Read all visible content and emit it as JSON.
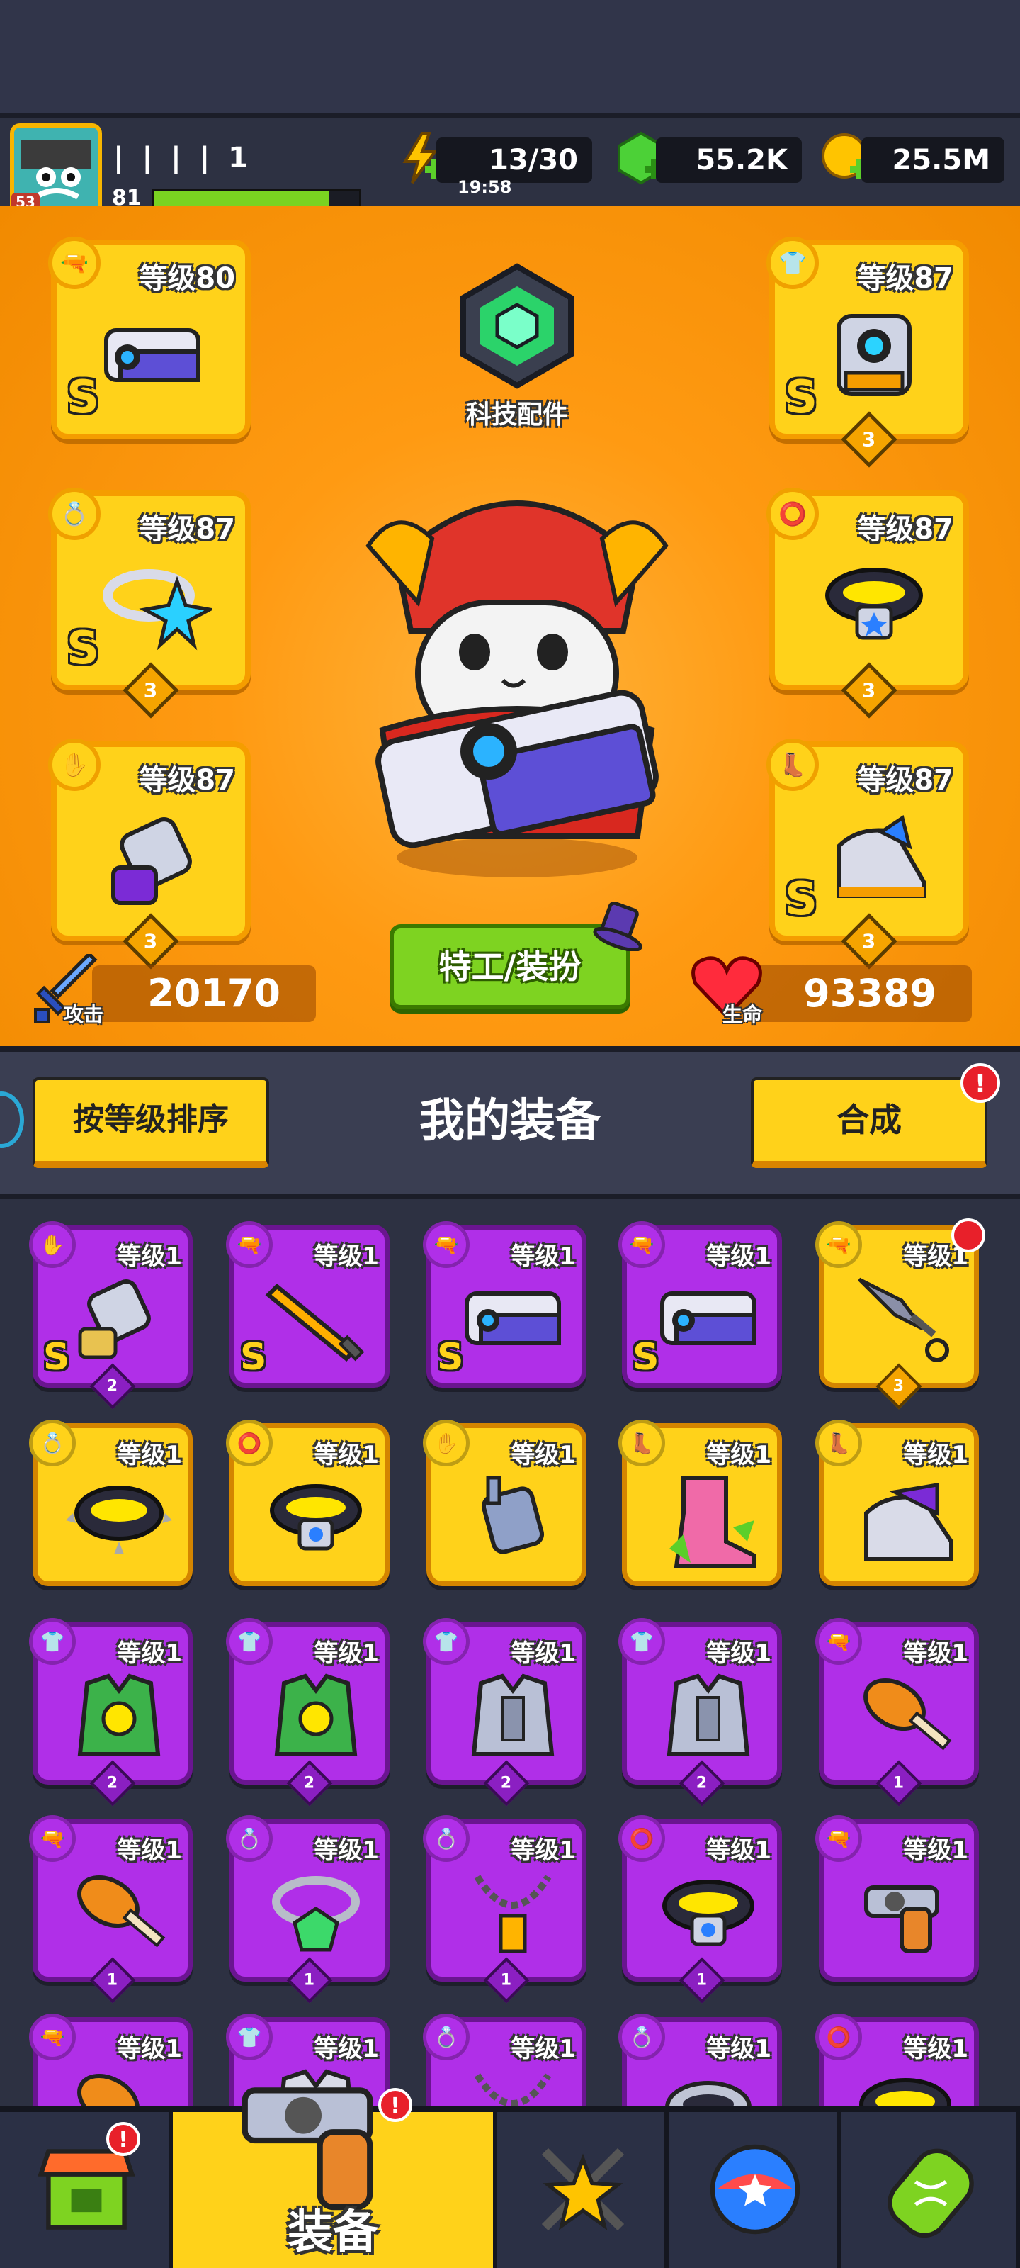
{
  "player": {
    "name": "| | | | 1",
    "level": "81",
    "avatar_badge": "53",
    "xp_fraction": 0.85
  },
  "resources": {
    "energy": {
      "value": "13/30",
      "timer": "19:58",
      "icon": "lightning-plus-icon"
    },
    "gems": {
      "value": "55.2K",
      "icon": "green-gem-plus-icon"
    },
    "coins": {
      "value": "25.5M",
      "icon": "gold-coin-plus-icon"
    }
  },
  "colors": {
    "accent": "#ff9a12",
    "gold": "#ffd21a",
    "purple": "#b02fe8",
    "green": "#7ed321",
    "alert": "#e8202a"
  },
  "equipped": {
    "weapon": {
      "level": "等级80",
      "rank": "S",
      "stars": ""
    },
    "armor": {
      "level": "等级87",
      "rank": "S",
      "stars": "3"
    },
    "ring": {
      "level": "等级87",
      "rank": "S",
      "stars": "3"
    },
    "belt": {
      "level": "等级87",
      "rank": "",
      "stars": "3"
    },
    "glove": {
      "level": "等级87",
      "rank": "",
      "stars": "3"
    },
    "boots": {
      "level": "等级87",
      "rank": "S",
      "stars": "3"
    }
  },
  "tech_label": "科技配件",
  "agent_button": "特工/装扮",
  "stats": {
    "attack_label": "攻击",
    "attack": "20170",
    "hp_label": "生命",
    "hp": "93389"
  },
  "inventory": {
    "sort_button": "按等级排序",
    "title": "我的装备",
    "merge_button": "合成",
    "merge_alert": "!",
    "items": [
      {
        "level": "等级1",
        "rank": "S",
        "stars": "2",
        "color": "purple",
        "slot": "glove",
        "icon": "gauntlet-icon"
      },
      {
        "level": "等级1",
        "rank": "S",
        "stars": "",
        "color": "purple",
        "slot": "weapon",
        "icon": "flame-sword-icon"
      },
      {
        "level": "等级1",
        "rank": "S",
        "stars": "",
        "color": "purple",
        "slot": "weapon",
        "icon": "blaster-icon"
      },
      {
        "level": "等级1",
        "rank": "S",
        "stars": "",
        "color": "purple",
        "slot": "weapon",
        "icon": "blaster-icon"
      },
      {
        "level": "等级1",
        "rank": "",
        "stars": "3",
        "color": "gold",
        "slot": "weapon",
        "icon": "kunai-icon",
        "alert": true
      },
      {
        "level": "等级1",
        "rank": "",
        "stars": "",
        "color": "gold",
        "slot": "ring",
        "icon": "spiked-collar-icon"
      },
      {
        "level": "等级1",
        "rank": "",
        "stars": "",
        "color": "gold",
        "slot": "belt",
        "icon": "belt-icon"
      },
      {
        "level": "等级1",
        "rank": "",
        "stars": "",
        "color": "gold",
        "slot": "glove",
        "icon": "steel-glove-icon"
      },
      {
        "level": "等级1",
        "rank": "",
        "stars": "",
        "color": "gold",
        "slot": "boots",
        "icon": "pink-boot-icon"
      },
      {
        "level": "等级1",
        "rank": "",
        "stars": "",
        "color": "gold",
        "slot": "boots",
        "icon": "sneaker-icon"
      },
      {
        "level": "等级1",
        "rank": "",
        "stars": "2",
        "color": "purple",
        "slot": "armor",
        "icon": "green-vest-icon"
      },
      {
        "level": "等级1",
        "rank": "",
        "stars": "2",
        "color": "purple",
        "slot": "armor",
        "icon": "green-vest-icon"
      },
      {
        "level": "等级1",
        "rank": "",
        "stars": "2",
        "color": "purple",
        "slot": "armor",
        "icon": "steel-armor-icon"
      },
      {
        "level": "等级1",
        "rank": "",
        "stars": "2",
        "color": "purple",
        "slot": "armor",
        "icon": "steel-armor-icon"
      },
      {
        "level": "等级1",
        "rank": "",
        "stars": "1",
        "color": "purple",
        "slot": "weapon",
        "icon": "drumstick-icon"
      },
      {
        "level": "等级1",
        "rank": "",
        "stars": "1",
        "color": "purple",
        "slot": "weapon",
        "icon": "drumstick-icon"
      },
      {
        "level": "等级1",
        "rank": "",
        "stars": "1",
        "color": "purple",
        "slot": "ring",
        "icon": "emerald-ring-icon"
      },
      {
        "level": "等级1",
        "rank": "",
        "stars": "1",
        "color": "purple",
        "slot": "ring",
        "icon": "chain-necklace-icon"
      },
      {
        "level": "等级1",
        "rank": "",
        "stars": "1",
        "color": "purple",
        "slot": "belt",
        "icon": "belt-icon"
      },
      {
        "level": "等级1",
        "rank": "",
        "stars": "",
        "color": "purple",
        "slot": "weapon",
        "icon": "revolver-icon"
      },
      {
        "level": "等级1",
        "rank": "",
        "stars": "",
        "color": "purple",
        "slot": "weapon",
        "icon": "drumstick-icon"
      },
      {
        "level": "等级1",
        "rank": "",
        "stars": "",
        "color": "purple",
        "slot": "armor",
        "icon": "armor-icon"
      },
      {
        "level": "等级1",
        "rank": "",
        "stars": "",
        "color": "purple",
        "slot": "ring",
        "icon": "chain-necklace-icon"
      },
      {
        "level": "等级1",
        "rank": "",
        "stars": "",
        "color": "purple",
        "slot": "ring",
        "icon": "collar-icon"
      },
      {
        "level": "等级1",
        "rank": "",
        "stars": "",
        "color": "purple",
        "slot": "belt",
        "icon": "belt-icon"
      }
    ]
  },
  "nav": {
    "tabs": [
      {
        "label": "",
        "icon": "shop-icon",
        "alert": true
      },
      {
        "label": "装备",
        "icon": "revolver-icon",
        "alert": true,
        "active": true
      },
      {
        "label": "",
        "icon": "crossed-swords-star-icon"
      },
      {
        "label": "",
        "icon": "star-ball-icon"
      },
      {
        "label": "",
        "icon": "dna-capsule-icon"
      }
    ]
  }
}
